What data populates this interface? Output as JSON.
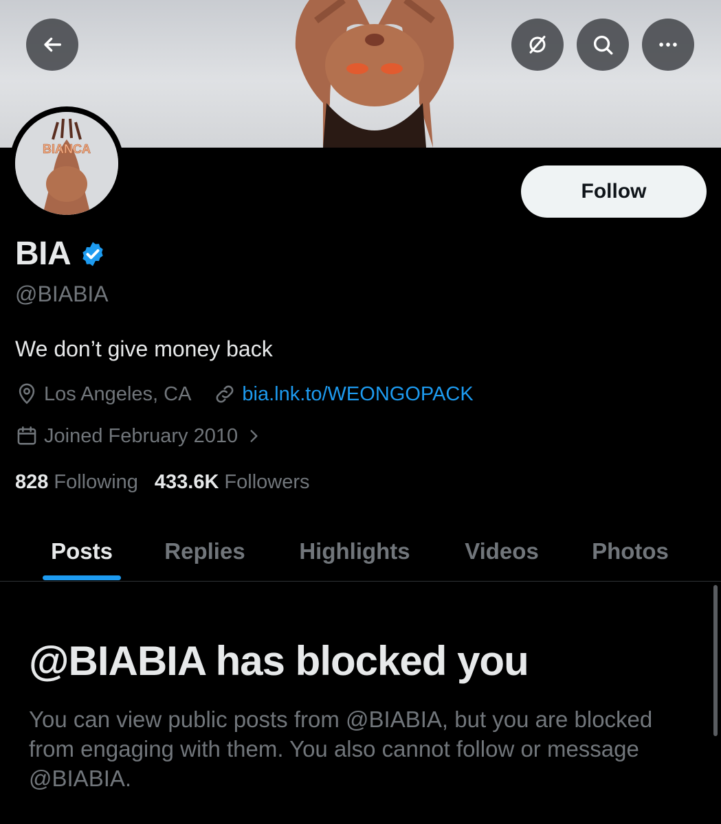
{
  "header": {
    "avatar_text": "BIANCA"
  },
  "profile": {
    "display_name": "BIA",
    "handle": "@BIABIA",
    "bio": "We don’t give money back",
    "location": "Los Angeles, CA",
    "link": "bia.lnk.to/WEONGOPACK",
    "joined": "Joined February 2010",
    "following_count": "828",
    "following_label": "Following",
    "followers_count": "433.6K",
    "followers_label": "Followers",
    "follow_label": "Follow"
  },
  "tabs": [
    {
      "label": "Posts",
      "active": true
    },
    {
      "label": "Replies",
      "active": false
    },
    {
      "label": "Highlights",
      "active": false
    },
    {
      "label": "Videos",
      "active": false
    },
    {
      "label": "Photos",
      "active": false
    }
  ],
  "blocked": {
    "title": "@BIABIA has blocked you",
    "body": "You can view public posts from @BIABIA, but you are blocked from engaging with them. You also cannot follow or message @BIABIA."
  },
  "colors": {
    "background": "#000000",
    "accent": "#1d9bf0",
    "text_primary": "#e7e9ea",
    "text_secondary": "#71767b",
    "follow_button_bg": "#eff3f4"
  },
  "icons": {
    "back": "arrow-left-icon",
    "grok": "slashed-circle-icon",
    "search": "search-icon",
    "more": "more-horizontal-icon",
    "verified": "verified-badge-icon",
    "location": "location-pin-icon",
    "link": "link-icon",
    "calendar": "calendar-icon",
    "chevron": "chevron-right-icon"
  }
}
